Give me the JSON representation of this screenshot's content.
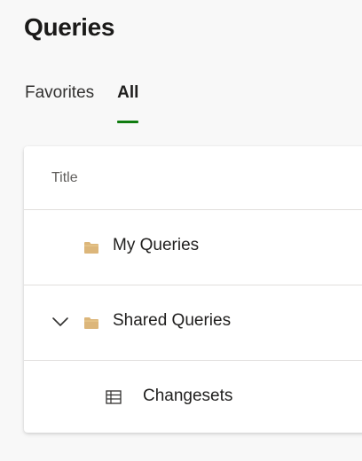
{
  "page": {
    "title": "Queries"
  },
  "tabs": [
    {
      "label": "Favorites",
      "active": false
    },
    {
      "label": "All",
      "active": true
    }
  ],
  "colors": {
    "tab_indicator": "#107c10",
    "folder": "#dcb67a"
  },
  "table": {
    "header": "Title",
    "rows": [
      {
        "label": "My Queries",
        "icon": "folder-icon",
        "expandable": false
      },
      {
        "label": "Shared Queries",
        "icon": "folder-icon",
        "expandable": true,
        "expanded": true
      },
      {
        "label": "Changesets",
        "icon": "query-list-icon",
        "expandable": false
      }
    ]
  }
}
